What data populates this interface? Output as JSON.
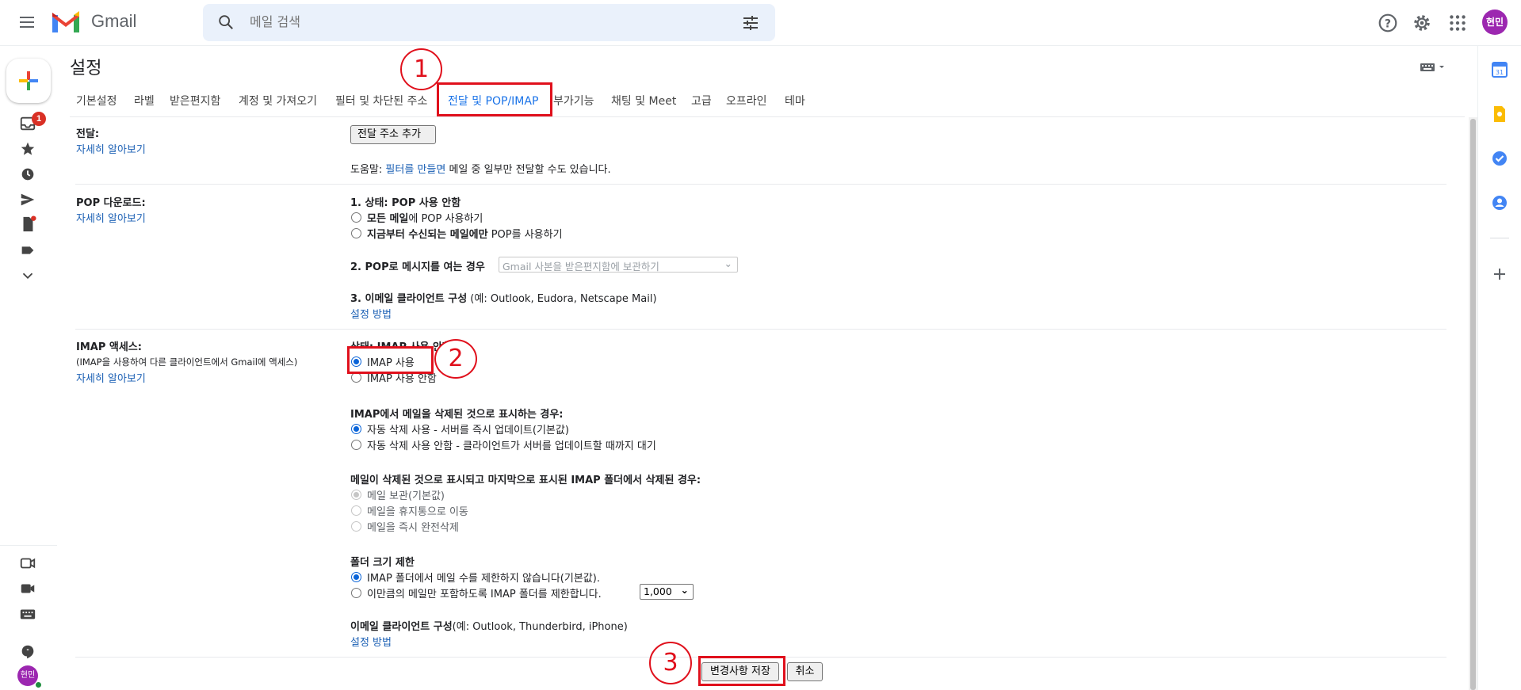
{
  "header": {
    "brand": "Gmail",
    "search_placeholder": "메일 검색",
    "avatar_initials": "현민"
  },
  "rail": {
    "inbox_badge": "1",
    "avatar_initials": "현민"
  },
  "settings": {
    "title": "설정",
    "tabs": [
      {
        "label": "기본설정"
      },
      {
        "label": "라벨"
      },
      {
        "label": "받은편지함"
      },
      {
        "label": "계정 및 가져오기"
      },
      {
        "label": "필터 및 차단된 주소"
      },
      {
        "label": "전달 및 POP/IMAP",
        "active": true
      },
      {
        "label": "부가기능"
      },
      {
        "label": "채팅 및 Meet"
      },
      {
        "label": "고급"
      },
      {
        "label": "오프라인"
      },
      {
        "label": "테마"
      }
    ],
    "annotations": [
      "1",
      "2",
      "3"
    ]
  },
  "forwarding": {
    "label": "전달:",
    "learn_more": "자세히 알아보기",
    "add_button": "전달 주소 추가",
    "help_prefix": "도움말: ",
    "help_link": "필터를 만들면",
    "help_suffix": " 메일 중 일부만 전달할 수도 있습니다."
  },
  "pop": {
    "label": "POP 다운로드:",
    "learn_more": "자세히 알아보기",
    "status": "1. 상태: POP 사용 안함",
    "option_all_bold": "모든 메일",
    "option_all_rest": "에 POP 사용하기",
    "option_new_bold": "지금부터 수신되는 메일에만",
    "option_new_rest": " POP를 사용하기",
    "when_access_label": "2. POP로 메시지를 여는 경우",
    "when_access_select": "Gmail 사본을 받은편지함에 보관하기",
    "client_config_bold": "3. 이메일 클라이언트 구성",
    "client_config_rest": " (예: Outlook, Eudora, Netscape Mail)",
    "config_link": "설정 방법"
  },
  "imap": {
    "label": "IMAP 액세스:",
    "sublabel": "(IMAP을 사용하여 다른 클라이언트에서 Gmail에 액세스)",
    "learn_more": "자세히 알아보기",
    "status": "상태: IMAP 사용 안함",
    "enable": "IMAP 사용",
    "disable": "IMAP 사용 안함",
    "delete_heading": "IMAP에서 메일을 삭제된 것으로 표시하는 경우:",
    "auto_expunge_on": "자동 삭제 사용 - 서버를 즉시 업데이트(기본값)",
    "auto_expunge_off": "자동 삭제 사용 안함 - 클라이언트가 서버를 업데이트할 때까지 대기",
    "expunge_heading": "메일이 삭제된 것으로 표시되고 마지막으로 표시된 IMAP 폴더에서 삭제된 경우:",
    "archive": "메일 보관(기본값)",
    "trash": "메일을 휴지통으로 이동",
    "delete_forever": "메일을 즉시 완전삭제",
    "folder_size_heading": "폴더 크기 제한",
    "no_limit": "IMAP 폴더에서 메일 수를 제한하지 않습니다(기본값).",
    "limit": "이만큼의 메일만 포함하도록 IMAP 폴더를 제한합니다.",
    "limit_value": "1,000",
    "client_config_bold": "이메일 클라이언트 구성",
    "client_config_rest": "(예: Outlook, Thunderbird, iPhone)",
    "config_link": "설정 방법"
  },
  "footer": {
    "save_label": "변경사항 저장",
    "cancel_label": "취소"
  },
  "colors": {
    "accent": "#1a73e8",
    "annotation_red": "#e0101c",
    "avatar": "#9c27b0"
  }
}
